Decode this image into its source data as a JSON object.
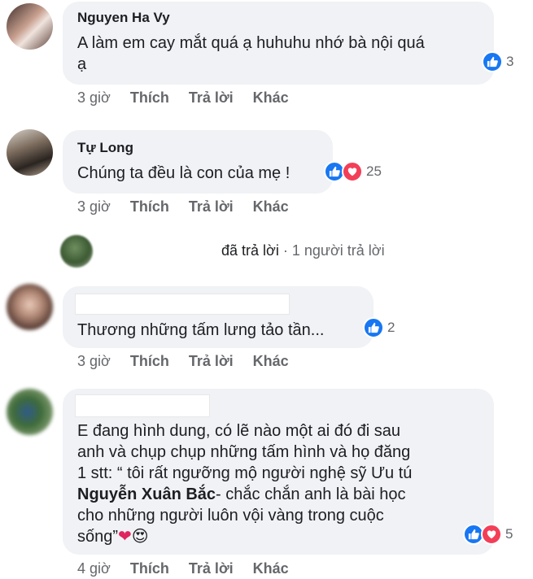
{
  "comments": [
    {
      "author": "Nguyen Ha Vy",
      "lines": [
        "A làm em cay mắt quá ạ huhuhu nhớ bà nội quá",
        "ạ"
      ],
      "reactions": {
        "types": [
          "like"
        ],
        "count": "3"
      },
      "time": "3 giờ"
    },
    {
      "author": "Tự Long",
      "lines": [
        "Chúng ta đều là con của mẹ !"
      ],
      "reactions": {
        "types": [
          "like",
          "love"
        ],
        "count": "25"
      },
      "time": "3 giờ",
      "reply_summary": {
        "action": "đã trả lời",
        "separator": "·",
        "count_text": "1 người trả lời"
      }
    },
    {
      "author": "",
      "lines": [
        "Thương những tấm lưng tảo tần..."
      ],
      "reactions": {
        "types": [
          "like"
        ],
        "count": "2"
      },
      "time": "3 giờ"
    },
    {
      "author": "",
      "lines": [
        "E đang hình dung, có lẽ nào một ai đó đi sau",
        "anh và chụp chụp những tấm hình và họ đăng",
        "1 stt: “ tôi rất ngưỡng mộ người nghệ sỹ Ưu tú",
        "cho những người luôn vội vàng trong cuộc",
        "sống”"
      ],
      "bold_name": "Nguyễn Xuân Bắc",
      "after_bold": "- chắc chắn anh là bài học",
      "reactions": {
        "types": [
          "like",
          "love"
        ],
        "count": "5"
      },
      "time": "4 giờ"
    }
  ],
  "actions": {
    "like": "Thích",
    "reply": "Trả lời",
    "more": "Khác"
  },
  "emoji": {
    "heart": "❤",
    "heart_eyes": "😍"
  },
  "colors": {
    "bubble": "#f0f2f5",
    "like": "#1877f2",
    "love": "#f33e58",
    "muted": "#65676b"
  }
}
